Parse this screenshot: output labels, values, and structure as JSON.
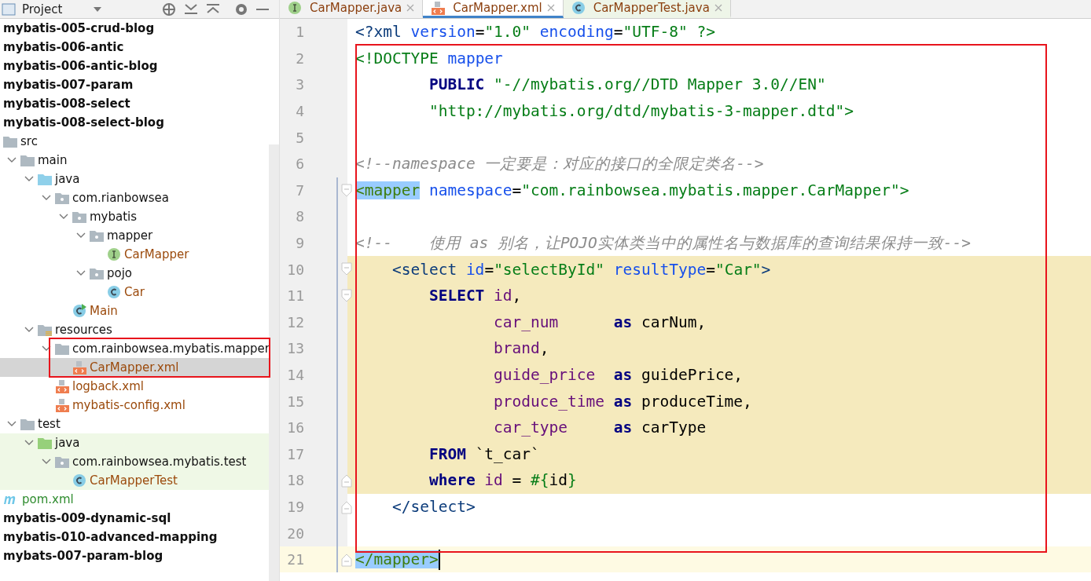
{
  "project_panel": {
    "title": "Project",
    "tree": [
      {
        "label": "mybatis-005-crud-blog",
        "kind": "module",
        "selected": false
      },
      {
        "label": "mybatis-006-antic",
        "kind": "module",
        "selected": false
      },
      {
        "label": "mybatis-006-antic-blog",
        "kind": "module",
        "selected": false
      },
      {
        "label": "mybatis-007-param",
        "kind": "module",
        "selected": false
      },
      {
        "label": "mybatis-008-select",
        "kind": "module",
        "selected": false
      },
      {
        "label": "mybatis-008-select-blog",
        "kind": "module",
        "selected": false
      },
      {
        "label": "src",
        "kind": "folder",
        "expanded": true,
        "selected": false,
        "children": [
          {
            "label": "main",
            "kind": "folder",
            "expanded": true,
            "selected": false,
            "children": [
              {
                "label": "java",
                "kind": "source",
                "expanded": true,
                "selected": false,
                "children": [
                  {
                    "label": "com.rianbowsea",
                    "kind": "package",
                    "expanded": true,
                    "selected": false,
                    "children": [
                      {
                        "label": "mybatis",
                        "kind": "package",
                        "expanded": true,
                        "selected": false,
                        "children": [
                          {
                            "label": "mapper",
                            "kind": "package",
                            "expanded": true,
                            "selected": false,
                            "children": [
                              {
                                "label": "CarMapper",
                                "kind": "interface",
                                "selected": false
                              }
                            ]
                          },
                          {
                            "label": "pojo",
                            "kind": "package",
                            "expanded": true,
                            "selected": false,
                            "children": [
                              {
                                "label": "Car",
                                "kind": "class",
                                "selected": false
                              }
                            ]
                          }
                        ]
                      },
                      {
                        "label": "Main",
                        "kind": "main-class",
                        "selected": false
                      }
                    ]
                  }
                ]
              },
              {
                "label": "resources",
                "kind": "resources",
                "expanded": true,
                "selected": false,
                "children": [
                  {
                    "label": "com.rainbowsea.mybatis.mapper",
                    "kind": "folder",
                    "expanded": true,
                    "selected": false,
                    "children": [
                      {
                        "label": "CarMapper.xml",
                        "kind": "xml",
                        "selected": true
                      }
                    ]
                  },
                  {
                    "label": "logback.xml",
                    "kind": "xml",
                    "selected": false
                  },
                  {
                    "label": "mybatis-config.xml",
                    "kind": "xml",
                    "selected": false
                  }
                ]
              }
            ]
          },
          {
            "label": "test",
            "kind": "folder",
            "expanded": true,
            "selected": false,
            "children": [
              {
                "label": "java",
                "kind": "test-source",
                "expanded": true,
                "selected": false,
                "children": [
                  {
                    "label": "com.rainbowsea.mybatis.test",
                    "kind": "package",
                    "expanded": true,
                    "selected": false,
                    "children": [
                      {
                        "label": "CarMapperTest",
                        "kind": "class",
                        "selected": false
                      }
                    ]
                  }
                ]
              }
            ]
          }
        ]
      },
      {
        "label": "pom.xml",
        "kind": "maven",
        "selected": false
      },
      {
        "label": "mybatis-009-dynamic-sql",
        "kind": "module",
        "selected": false
      },
      {
        "label": "mybatis-010-advanced-mapping",
        "kind": "module",
        "selected": false
      },
      {
        "label": "mybats-007-param-blog",
        "kind": "module",
        "selected": false
      }
    ]
  },
  "editor_tabs": [
    {
      "label": "CarMapper.java",
      "kind": "interface",
      "selected": false
    },
    {
      "label": "CarMapper.xml",
      "kind": "xml",
      "selected": true
    },
    {
      "label": "CarMapperTest.java",
      "kind": "class",
      "selected": false
    }
  ],
  "editor": {
    "lines": [
      {
        "number": "1",
        "highlighted": false,
        "current": false,
        "fold_start": false,
        "fold_end": false,
        "cursor": false,
        "segments": [
          {
            "kind": "tag",
            "text": "<?xml"
          },
          {
            "kind": "attr",
            "text": " version"
          },
          {
            "kind": "punct",
            "text": "="
          },
          {
            "kind": "value",
            "text": "\"1.0\""
          },
          {
            "kind": "attr",
            "text": " encoding"
          },
          {
            "kind": "punct",
            "text": "="
          },
          {
            "kind": "value",
            "text": "\"UTF-8\" ?>"
          }
        ]
      },
      {
        "number": "2",
        "highlighted": false,
        "current": false,
        "fold_start": false,
        "fold_end": false,
        "cursor": false,
        "segments": [
          {
            "kind": "value",
            "text": "<!DOCTYPE"
          },
          {
            "kind": "attr",
            "text": " mapper"
          }
        ]
      },
      {
        "number": "3",
        "highlighted": false,
        "current": false,
        "fold_start": false,
        "fold_end": false,
        "cursor": false,
        "segments": [
          {
            "kind": "keyword",
            "text": "        PUBLIC"
          },
          {
            "kind": "value",
            "text": " \"-//mybatis.org//DTD Mapper 3.0//EN\""
          }
        ]
      },
      {
        "number": "4",
        "highlighted": false,
        "current": false,
        "fold_start": false,
        "fold_end": false,
        "cursor": false,
        "segments": [
          {
            "kind": "value",
            "text": "        \"http://mybatis.org/dtd/mybatis-3-mapper.dtd\">"
          }
        ]
      },
      {
        "number": "5",
        "highlighted": false,
        "current": false,
        "fold_start": false,
        "fold_end": false,
        "cursor": false
      },
      {
        "number": "6",
        "highlighted": false,
        "current": false,
        "fold_start": false,
        "fold_end": false,
        "cursor": false,
        "segments": [
          {
            "kind": "comment",
            "text": "<!--namespace 一定要是：对应的接口的全限定类名-->"
          }
        ]
      },
      {
        "number": "7",
        "highlighted": false,
        "current": false,
        "fold_start": true,
        "fold_end": false,
        "cursor": false,
        "segments": [
          {
            "kind": "match",
            "text": "<mapper"
          },
          {
            "kind": "attr",
            "text": " namespace"
          },
          {
            "kind": "punct",
            "text": "="
          },
          {
            "kind": "value",
            "text": "\"com.rainbowsea.mybatis.mapper.CarMapper\">"
          }
        ]
      },
      {
        "number": "8",
        "highlighted": false,
        "current": false,
        "fold_start": false,
        "fold_end": false,
        "cursor": false
      },
      {
        "number": "9",
        "highlighted": false,
        "current": false,
        "fold_start": false,
        "fold_end": false,
        "cursor": false,
        "segments": [
          {
            "kind": "comment",
            "text": "<!--    使用 as 别名，让POJO实体类当中的属性名与数据库的查询结果保持一致-->"
          }
        ]
      },
      {
        "number": "10",
        "highlighted": true,
        "current": false,
        "fold_start": true,
        "fold_end": false,
        "cursor": false,
        "segments": [
          {
            "kind": "tag",
            "text": "    <select"
          },
          {
            "kind": "attr",
            "text": " id"
          },
          {
            "kind": "punct",
            "text": "="
          },
          {
            "kind": "value",
            "text": "\"selectById\""
          },
          {
            "kind": "attr",
            "text": " resultType"
          },
          {
            "kind": "punct",
            "text": "="
          },
          {
            "kind": "value",
            "text": "\"Car\""
          },
          {
            "kind": "tag",
            "text": ">"
          }
        ]
      },
      {
        "number": "11",
        "highlighted": true,
        "current": false,
        "fold_start": true,
        "fold_end": false,
        "cursor": false,
        "segments": [
          {
            "kind": "keyword",
            "text": "        SELECT"
          },
          {
            "kind": "column",
            "text": " id"
          },
          {
            "kind": "plain",
            "text": ","
          }
        ]
      },
      {
        "number": "12",
        "highlighted": true,
        "current": false,
        "fold_start": false,
        "fold_end": false,
        "cursor": false,
        "segments": [
          {
            "kind": "column",
            "text": "               car_num"
          },
          {
            "kind": "keyword",
            "text": "      as"
          },
          {
            "kind": "plain",
            "text": " carNum,"
          }
        ]
      },
      {
        "number": "13",
        "highlighted": true,
        "current": false,
        "fold_start": false,
        "fold_end": false,
        "cursor": false,
        "segments": [
          {
            "kind": "column",
            "text": "               brand"
          },
          {
            "kind": "plain",
            "text": ","
          }
        ]
      },
      {
        "number": "14",
        "highlighted": true,
        "current": false,
        "fold_start": false,
        "fold_end": false,
        "cursor": false,
        "segments": [
          {
            "kind": "column",
            "text": "               guide_price"
          },
          {
            "kind": "keyword",
            "text": "  as"
          },
          {
            "kind": "plain",
            "text": " guidePrice,"
          }
        ]
      },
      {
        "number": "15",
        "highlighted": true,
        "current": false,
        "fold_start": false,
        "fold_end": false,
        "cursor": false,
        "segments": [
          {
            "kind": "column",
            "text": "               produce_time"
          },
          {
            "kind": "keyword",
            "text": " as"
          },
          {
            "kind": "plain",
            "text": " produceTime,"
          }
        ]
      },
      {
        "number": "16",
        "highlighted": true,
        "current": false,
        "fold_start": false,
        "fold_end": false,
        "cursor": false,
        "segments": [
          {
            "kind": "column",
            "text": "               car_type"
          },
          {
            "kind": "keyword",
            "text": "     as"
          },
          {
            "kind": "plain",
            "text": " carType"
          }
        ]
      },
      {
        "number": "17",
        "highlighted": true,
        "current": false,
        "fold_start": false,
        "fold_end": false,
        "cursor": false,
        "segments": [
          {
            "kind": "keyword",
            "text": "        FROM"
          },
          {
            "kind": "plain",
            "text": " `t_car`"
          }
        ]
      },
      {
        "number": "18",
        "highlighted": true,
        "current": false,
        "fold_start": false,
        "fold_end": true,
        "cursor": false,
        "segments": [
          {
            "kind": "keyword",
            "text": "        where"
          },
          {
            "kind": "column",
            "text": " id"
          },
          {
            "kind": "plain",
            "text": " ="
          },
          {
            "kind": "value",
            "text": " #{"
          },
          {
            "kind": "plain",
            "text": "id"
          },
          {
            "kind": "value",
            "text": "}"
          }
        ]
      },
      {
        "number": "19",
        "highlighted": false,
        "current": false,
        "fold_start": false,
        "fold_end": true,
        "cursor": false,
        "segments": [
          {
            "kind": "tag",
            "text": "    </select>"
          }
        ]
      },
      {
        "number": "20",
        "highlighted": false,
        "current": false,
        "fold_start": false,
        "fold_end": false,
        "cursor": false
      },
      {
        "number": "21",
        "highlighted": false,
        "current": true,
        "fold_start": false,
        "fold_end": true,
        "cursor": true,
        "segments": [
          {
            "kind": "match",
            "text": "</mapper>"
          }
        ]
      }
    ]
  }
}
